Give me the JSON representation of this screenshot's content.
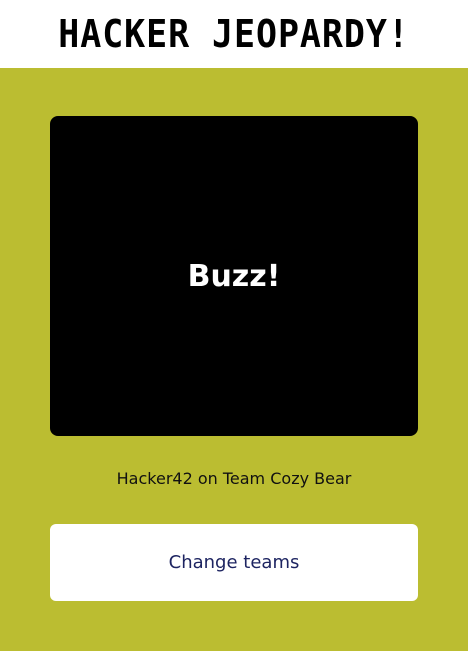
{
  "header": {
    "title": "HACKER JEOPARDY!"
  },
  "buzzer": {
    "label": "Buzz!"
  },
  "player": {
    "info": "Hacker42 on Team Cozy Bear"
  },
  "actions": {
    "change_teams_label": "Change teams"
  },
  "colors": {
    "background": "#bbbd31",
    "header_background": "#ffffff",
    "buzzer_background": "#000000",
    "button_text": "#1d2461"
  }
}
